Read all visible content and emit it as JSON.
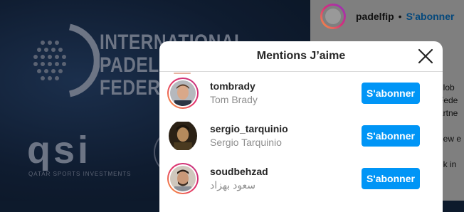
{
  "background": {
    "federation_lines": [
      "INTERNATIONAL",
      "PADEL",
      "FEDERATION"
    ],
    "sponsor_logo": "qsi",
    "sponsor_subtitle": "QATAR SPORTS INVESTMENTS"
  },
  "post": {
    "username": "padelfip",
    "separator": "•",
    "follow_label": "S'abonner",
    "caption_fragments": [
      "glob",
      "Fede",
      "artne",
      "new e",
      "nk in"
    ]
  },
  "modal": {
    "title": "Mentions J’aime",
    "close_icon": "close-icon",
    "users": [
      {
        "handle": "tombrady",
        "full_name": "Tom Brady",
        "follow_label": "S'abonner",
        "has_story": true
      },
      {
        "handle": "sergio_tarquinio",
        "full_name": "Sergio Tarquinio",
        "follow_label": "S'abonner",
        "has_story": false
      },
      {
        "handle": "soudbehzad",
        "full_name": "سعود بهزاد",
        "follow_label": "S'abonner",
        "has_story": true
      }
    ]
  },
  "colors": {
    "follow_button": "#0095f6",
    "story_ring": "#e2336b",
    "muted_text": "#8e8e8e"
  }
}
